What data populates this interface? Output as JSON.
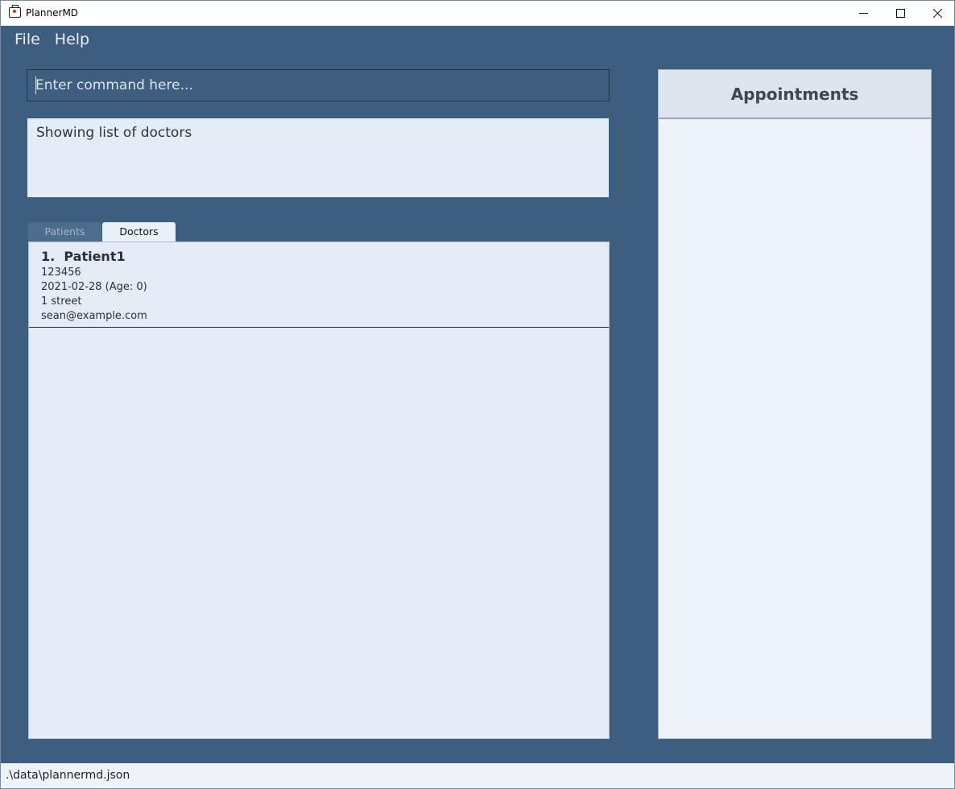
{
  "window": {
    "title": "PlannerMD"
  },
  "menu": {
    "items": [
      "File",
      "Help"
    ]
  },
  "command": {
    "placeholder": "Enter command here...",
    "value": ""
  },
  "result": {
    "text": "Showing list of doctors"
  },
  "tabs": [
    {
      "label": "Patients",
      "active": false
    },
    {
      "label": "Doctors",
      "active": true
    }
  ],
  "list": {
    "items": [
      {
        "title": "1.  Patient1",
        "phone": "123456",
        "dob": "2021-02-28 (Age: 0)",
        "address": "1 street",
        "email": "sean@example.com"
      }
    ]
  },
  "appointments": {
    "title": "Appointments"
  },
  "status": {
    "path": ".\\data\\plannermd.json"
  },
  "colors": {
    "background": "#3d5e7e",
    "panel": "#e4edf7",
    "appointments_panel": "#edf3f9"
  }
}
